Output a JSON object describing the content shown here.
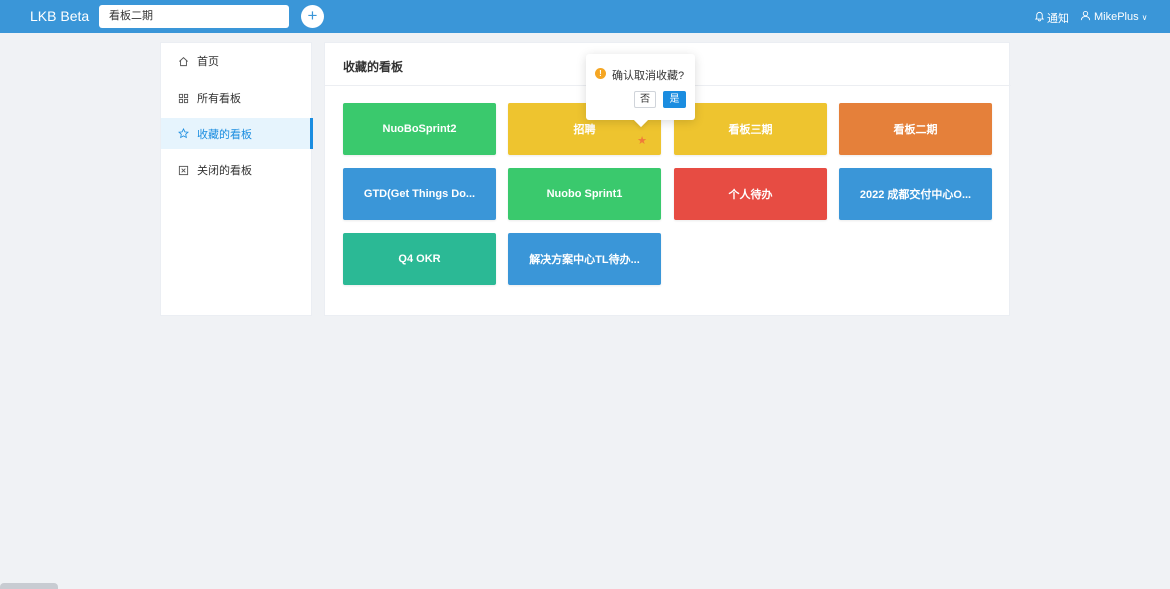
{
  "topbar": {
    "brand": "LKB Beta",
    "board_selector_value": "看板二期",
    "add_symbol": "+",
    "notify_label": "通知",
    "user_name": "MikePlus",
    "user_caret": "∨"
  },
  "sidebar": {
    "items": [
      {
        "label": "首页",
        "icon": "home-icon",
        "active": false
      },
      {
        "label": "所有看板",
        "icon": "grid-icon",
        "active": false
      },
      {
        "label": "收藏的看板",
        "icon": "star-icon",
        "active": true
      },
      {
        "label": "关闭的看板",
        "icon": "close-box-icon",
        "active": false
      }
    ]
  },
  "main": {
    "title": "收藏的看板",
    "boards": [
      {
        "label": "NuoBoSprint2",
        "color": "#3ac96d"
      },
      {
        "label": "招聘",
        "color": "#eec42f",
        "starred_hover": true
      },
      {
        "label": "看板三期",
        "color": "#eec42f"
      },
      {
        "label": "看板二期",
        "color": "#e5803a"
      },
      {
        "label": "GTD(Get Things Do...",
        "color": "#3a96d8"
      },
      {
        "label": "Nuobo Sprint1",
        "color": "#3ac96d"
      },
      {
        "label": "个人待办",
        "color": "#e74c43"
      },
      {
        "label": "2022 成都交付中心O...",
        "color": "#3a96d8"
      },
      {
        "label": "Q4 OKR",
        "color": "#2bb995"
      },
      {
        "label": "解决方案中心TL待办...",
        "color": "#3a96d8"
      }
    ],
    "star_glyph": "★"
  },
  "popover": {
    "message": "确认取消收藏?",
    "warn_glyph": "!",
    "no_label": "否",
    "yes_label": "是"
  }
}
